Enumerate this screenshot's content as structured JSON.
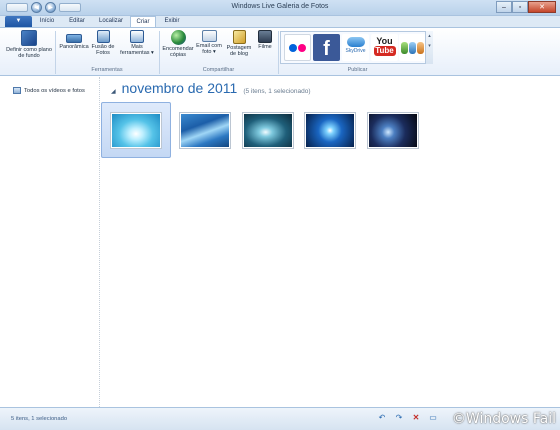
{
  "window": {
    "title": "Windows Live Galeria de Fotos",
    "file_tab": "▼"
  },
  "tabs": [
    {
      "label": "Início"
    },
    {
      "label": "Editar"
    },
    {
      "label": "Localizar"
    },
    {
      "label": "Criar"
    },
    {
      "label": "Exibir"
    }
  ],
  "ribbon": {
    "buttons": {
      "set_background": "Definir como plano de fundo",
      "panoramic": "Panorâmica",
      "photo_fuse": "Fusão de Fotos",
      "more_tools": "Mais ferramentas ▾",
      "order_prints": "Encomendar cópias",
      "email_photo": "Email com foto ▾",
      "blog_post": "Postagem de blog",
      "movie": "Filme"
    },
    "groups": {
      "tools": "Ferramentas",
      "share": "Compartilhar",
      "publish": "Publicar"
    },
    "publish": {
      "skydrive": "SkyDrive",
      "youtube_you": "You",
      "youtube_tube": "Tube",
      "facebook": "f"
    }
  },
  "nav": {
    "all_items": "Todos os vídeos e fotos"
  },
  "gallery": {
    "group_title": "novembro de 2011",
    "group_count": "(5 itens, 1 selecionado)",
    "thumbs": [
      {
        "name": "thumb-1",
        "selected": true
      },
      {
        "name": "thumb-2",
        "selected": false
      },
      {
        "name": "thumb-3",
        "selected": false
      },
      {
        "name": "thumb-4",
        "selected": false
      },
      {
        "name": "thumb-5",
        "selected": false
      }
    ]
  },
  "status": {
    "text": "5 itens, 1 selecionado",
    "watermark": "©Windows Fail"
  },
  "colors": {
    "accent": "#2a6ab0",
    "ribbon_bg": "#e7effa",
    "selection": "#c4d8f4"
  }
}
